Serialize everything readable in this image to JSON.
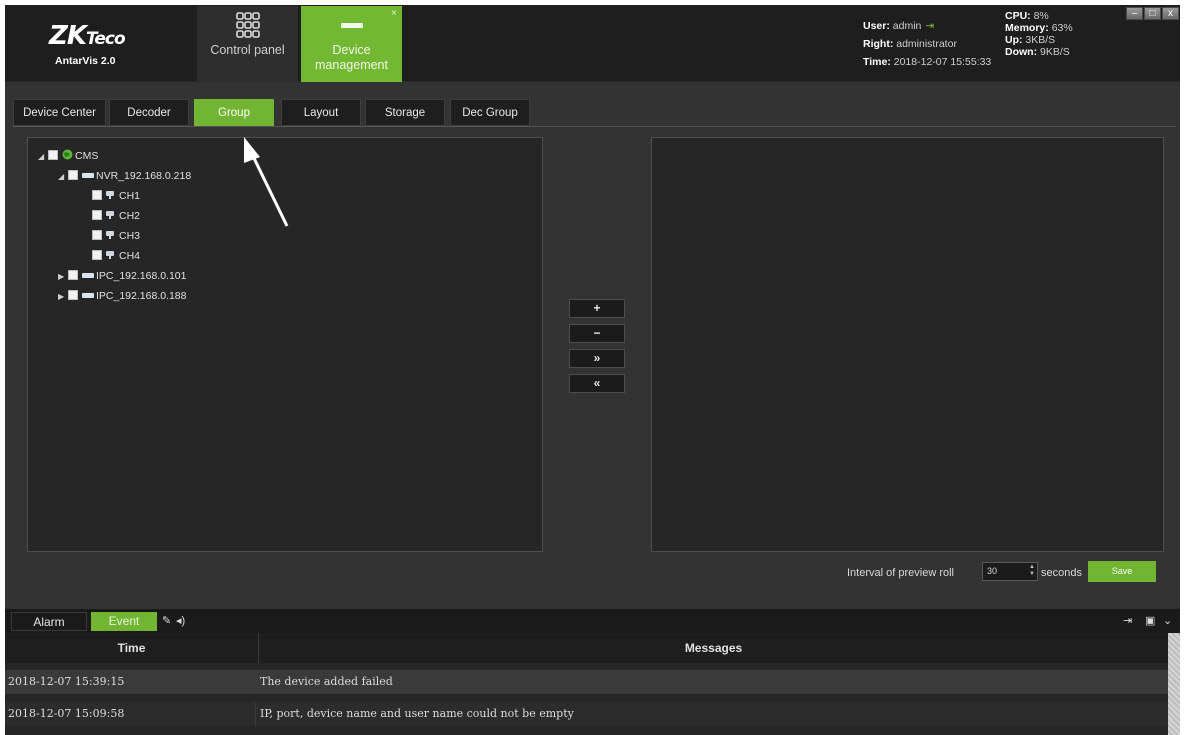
{
  "app": {
    "logo_brand": "ZK",
    "logo_brand_suffix": "Teco",
    "logo_product": "AntarVis 2.0"
  },
  "modules": {
    "control_panel": "Control panel",
    "device_management": "Device management",
    "close_glyph": "×"
  },
  "session": {
    "user_label": "User:",
    "user_value": "admin",
    "right_label": "Right:",
    "right_value": "administrator",
    "time_label": "Time:",
    "time_value": "2018-12-07 15:55:33"
  },
  "system": {
    "cpu_label": "CPU:",
    "cpu_value": "8%",
    "memory_label": "Memory:",
    "memory_value": "63%",
    "up_label": "Up:",
    "up_value": "3KB/S",
    "down_label": "Down:",
    "down_value": "9KB/S"
  },
  "window_controls": {
    "minimize": "–",
    "maximize": "□",
    "close": "x"
  },
  "tabs": [
    {
      "label": "Device Center",
      "active": false
    },
    {
      "label": "Decoder",
      "active": false
    },
    {
      "label": "Group",
      "active": true
    },
    {
      "label": "Layout",
      "active": false
    },
    {
      "label": "Storage",
      "active": false
    },
    {
      "label": "Dec Group",
      "active": false
    }
  ],
  "tree": {
    "root": "CMS",
    "nvr": "NVR_192.168.0.218",
    "channels": [
      "CH1",
      "CH2",
      "CH3",
      "CH4"
    ],
    "ipc1": "IPC_192.168.0.101",
    "ipc2": "IPC_192.168.0.188"
  },
  "transfer_buttons": {
    "add": "+",
    "remove": "−",
    "add_all": "»",
    "remove_all": "«"
  },
  "preview": {
    "interval_label": "Interval of preview roll",
    "interval_value": "30",
    "seconds_label": "seconds",
    "save_label": "Save"
  },
  "log": {
    "tabs": [
      "Alarm",
      "Event"
    ],
    "columns": [
      "Time",
      "Messages"
    ],
    "rows": [
      {
        "time": "2018-12-07 15:39:15",
        "message": "The device added failed"
      },
      {
        "time": "2018-12-07 15:09:58",
        "message": "IP, port, device name and user name could not be empty"
      }
    ]
  },
  "colors": {
    "accent": "#72b532",
    "background": "#333333",
    "panel": "#262626",
    "titlebar": "#1e1e1e"
  }
}
